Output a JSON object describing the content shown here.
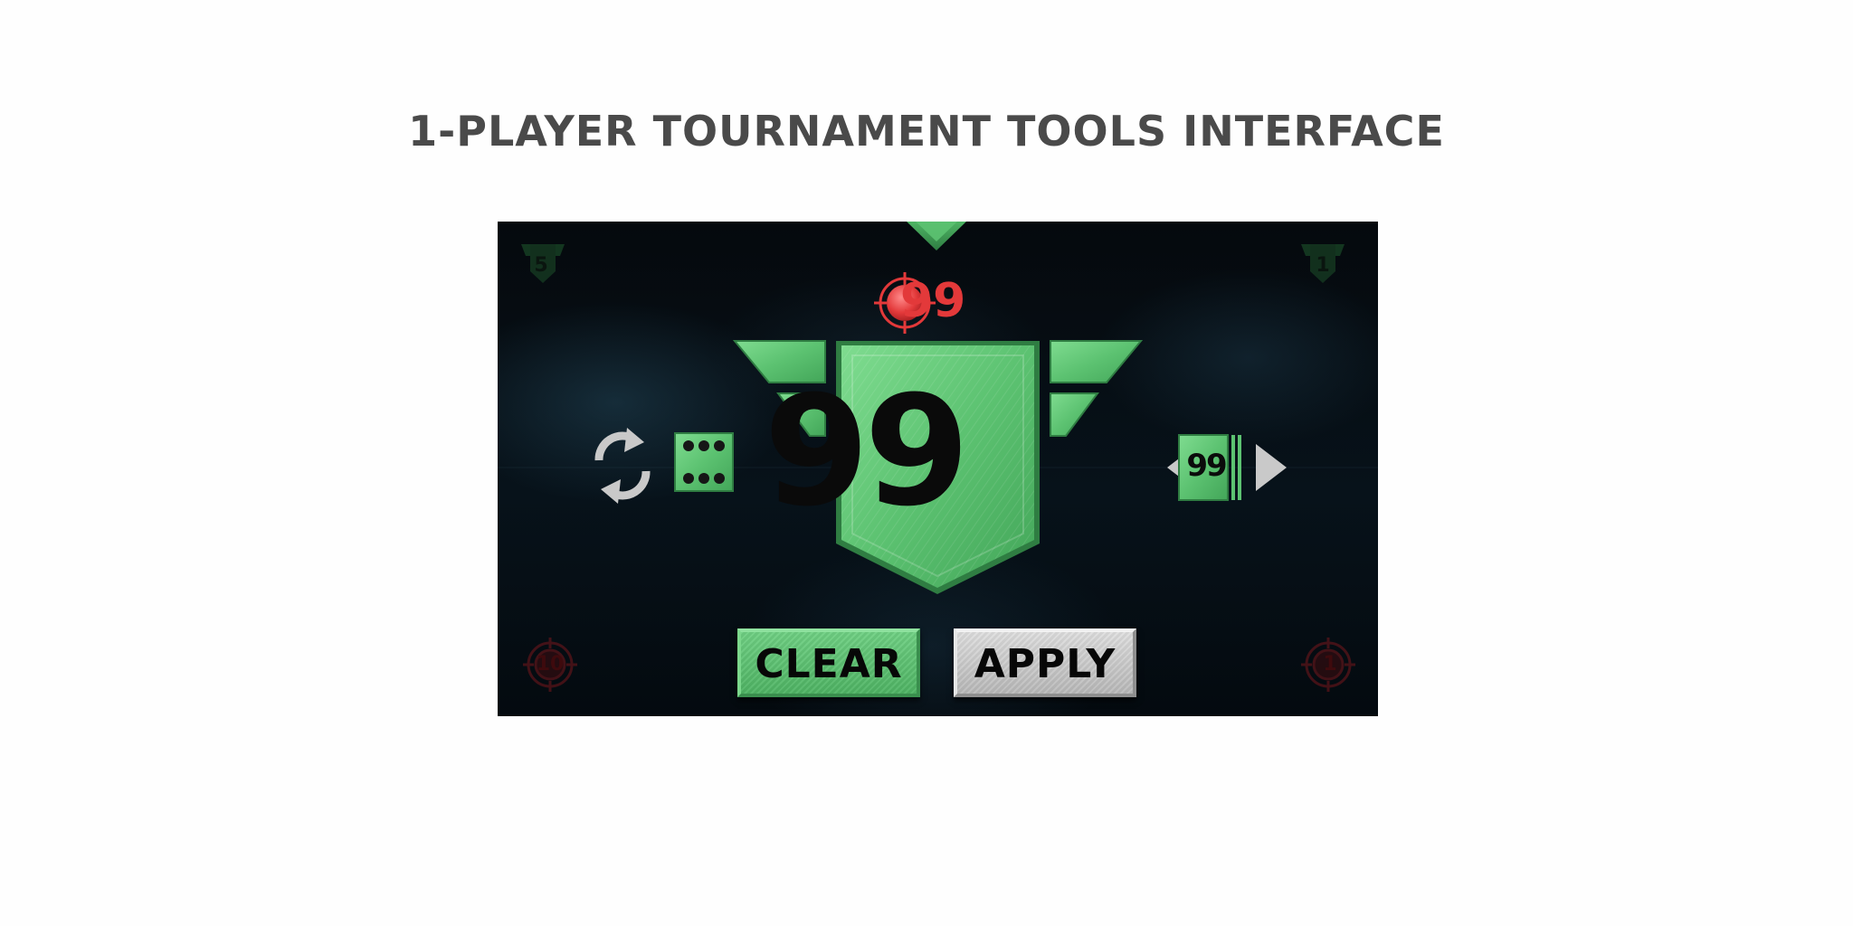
{
  "page": {
    "title": "1-PLAYER TOURNAMENT TOOLS INTERFACE"
  },
  "score": {
    "value": "99",
    "icon": "crosshair-target-icon",
    "color": "#e3393a"
  },
  "main_badge": {
    "value": "99",
    "color": "#5cc271"
  },
  "card_selector": {
    "value": "99"
  },
  "corners": {
    "top_left": "5",
    "top_right": "1",
    "bottom_left": "10",
    "bottom_right": "1"
  },
  "left_tools": {
    "icons": [
      "refresh-icon",
      "dice-six-icon"
    ]
  },
  "buttons": {
    "clear": "CLEAR",
    "apply": "APPLY"
  },
  "colors": {
    "accent_green": "#5cc271",
    "target_red": "#e3393a",
    "button_silver": "#cfcfcf"
  }
}
